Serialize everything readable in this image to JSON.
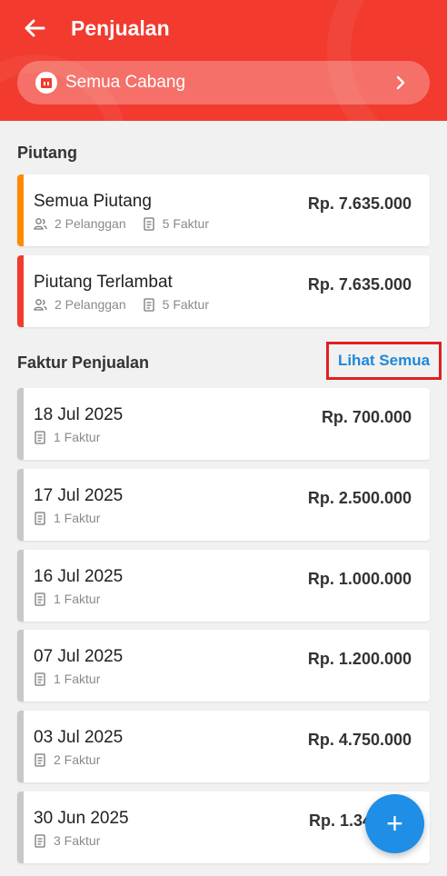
{
  "header": {
    "title": "Penjualan",
    "branch_label": "Semua Cabang"
  },
  "piutang": {
    "section_title": "Piutang",
    "cards": [
      {
        "title": "Semua Piutang",
        "amount": "Rp. 7.635.000",
        "customers": "2 Pelanggan",
        "invoices": "5 Faktur",
        "stripe_color": "#ff8a00"
      },
      {
        "title": "Piutang Terlambat",
        "amount": "Rp. 7.635.000",
        "customers": "2 Pelanggan",
        "invoices": "5 Faktur",
        "stripe_color": "#f23a2e"
      }
    ]
  },
  "faktur": {
    "section_title": "Faktur Penjualan",
    "see_all_label": "Lihat Semua",
    "items": [
      {
        "date": "18 Jul 2025",
        "amount": "Rp. 700.000",
        "count": "1 Faktur"
      },
      {
        "date": "17 Jul 2025",
        "amount": "Rp. 2.500.000",
        "count": "1 Faktur"
      },
      {
        "date": "16 Jul 2025",
        "amount": "Rp. 1.000.000",
        "count": "1 Faktur"
      },
      {
        "date": "07 Jul 2025",
        "amount": "Rp. 1.200.000",
        "count": "1 Faktur"
      },
      {
        "date": "03 Jul 2025",
        "amount": "Rp. 4.750.000",
        "count": "2 Faktur"
      },
      {
        "date": "30 Jun 2025",
        "amount": "Rp. 1.34",
        "count": "3 Faktur"
      }
    ]
  },
  "fab": {
    "label": "+"
  },
  "colors": {
    "header": "#f23a2e",
    "accent_link": "#1e88d8",
    "fab": "#1e8ee6",
    "neutral_stripe": "#c8c8c8"
  }
}
